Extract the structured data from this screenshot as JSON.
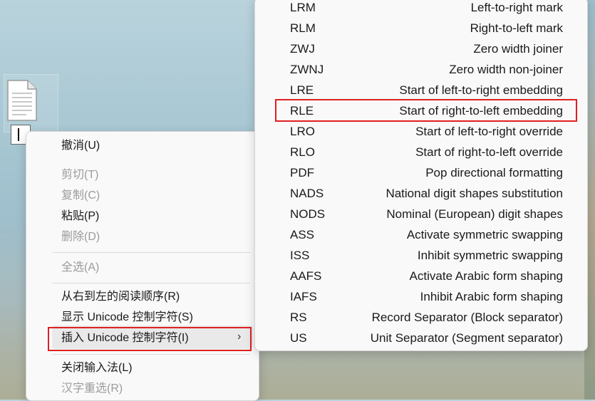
{
  "context_menu": {
    "items": [
      {
        "label": "撤消(U)",
        "enabled": true
      },
      {
        "label": "剪切(T)",
        "enabled": false
      },
      {
        "label": "复制(C)",
        "enabled": false
      },
      {
        "label": "粘贴(P)",
        "enabled": true
      },
      {
        "label": "删除(D)",
        "enabled": false
      },
      {
        "label": "全选(A)",
        "enabled": false
      },
      {
        "label": "从右到左的阅读顺序(R)",
        "enabled": true
      },
      {
        "label": "显示 Unicode 控制字符(S)",
        "enabled": true
      },
      {
        "label": "插入 Unicode 控制字符(I)",
        "enabled": true
      },
      {
        "label": "关闭输入法(L)",
        "enabled": true
      },
      {
        "label": "汉字重选(R)",
        "enabled": false
      }
    ],
    "submenu_chevron": "›"
  },
  "unicode_submenu": {
    "items": [
      {
        "abbr": "LRM",
        "desc": "Left-to-right mark"
      },
      {
        "abbr": "RLM",
        "desc": "Right-to-left mark"
      },
      {
        "abbr": "ZWJ",
        "desc": "Zero width joiner"
      },
      {
        "abbr": "ZWNJ",
        "desc": "Zero width non-joiner"
      },
      {
        "abbr": "LRE",
        "desc": "Start of left-to-right embedding"
      },
      {
        "abbr": "RLE",
        "desc": "Start of right-to-left embedding"
      },
      {
        "abbr": "LRO",
        "desc": "Start of left-to-right override"
      },
      {
        "abbr": "RLO",
        "desc": "Start of right-to-left override"
      },
      {
        "abbr": "PDF",
        "desc": "Pop directional formatting"
      },
      {
        "abbr": "NADS",
        "desc": "National digit shapes substitution"
      },
      {
        "abbr": "NODS",
        "desc": "Nominal (European) digit shapes"
      },
      {
        "abbr": "ASS",
        "desc": "Activate symmetric swapping"
      },
      {
        "abbr": "ISS",
        "desc": "Inhibit symmetric swapping"
      },
      {
        "abbr": "AAFS",
        "desc": "Activate Arabic form shaping"
      },
      {
        "abbr": "IAFS",
        "desc": "Inhibit Arabic form shaping"
      },
      {
        "abbr": "RS",
        "desc": "Record Separator (Block separator)"
      },
      {
        "abbr": "US",
        "desc": "Unit Separator (Segment separator)"
      }
    ]
  },
  "colors": {
    "highlight_border": "#e02020",
    "menu_bg": "#f9f9f9",
    "disabled_text": "#9b9b9b"
  },
  "icons": [
    "document-file-icon",
    "text-caret-icon",
    "chevron-right-icon"
  ]
}
